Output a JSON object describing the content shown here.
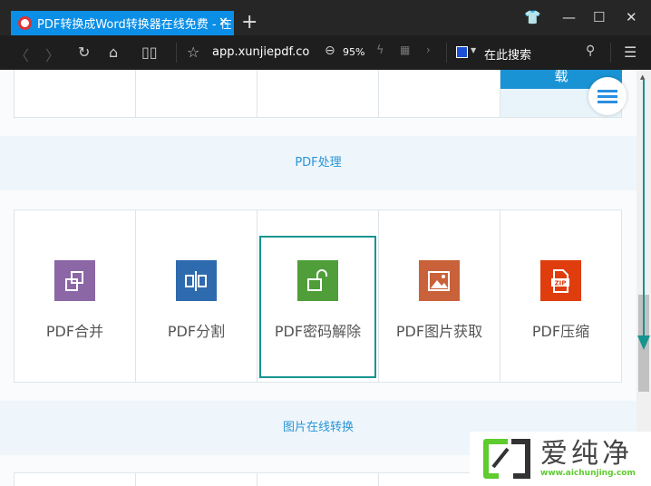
{
  "browser": {
    "tab_title": "PDF转换成Word转换器在线免费 - 在",
    "new_tab": "+",
    "url": "app.xunjiepdf.co",
    "zoom": "95%",
    "search_placeholder": "在此搜索"
  },
  "page": {
    "top_button_fragment": "载",
    "section1_title": "PDF处理",
    "tools": [
      {
        "label": "PDF合并",
        "color": "#8b67a6"
      },
      {
        "label": "PDF分割",
        "color": "#2e6aae"
      },
      {
        "label": "PDF密码解除",
        "color": "#4f9e3a"
      },
      {
        "label": "PDF图片获取",
        "color": "#c9623a"
      },
      {
        "label": "PDF压缩",
        "color": "#e03d0f"
      }
    ],
    "section2_title": "图片在线转换"
  },
  "watermark": {
    "name": "爱纯净",
    "url": "www.aichunjing.com"
  },
  "annotation_color": "#16948f"
}
